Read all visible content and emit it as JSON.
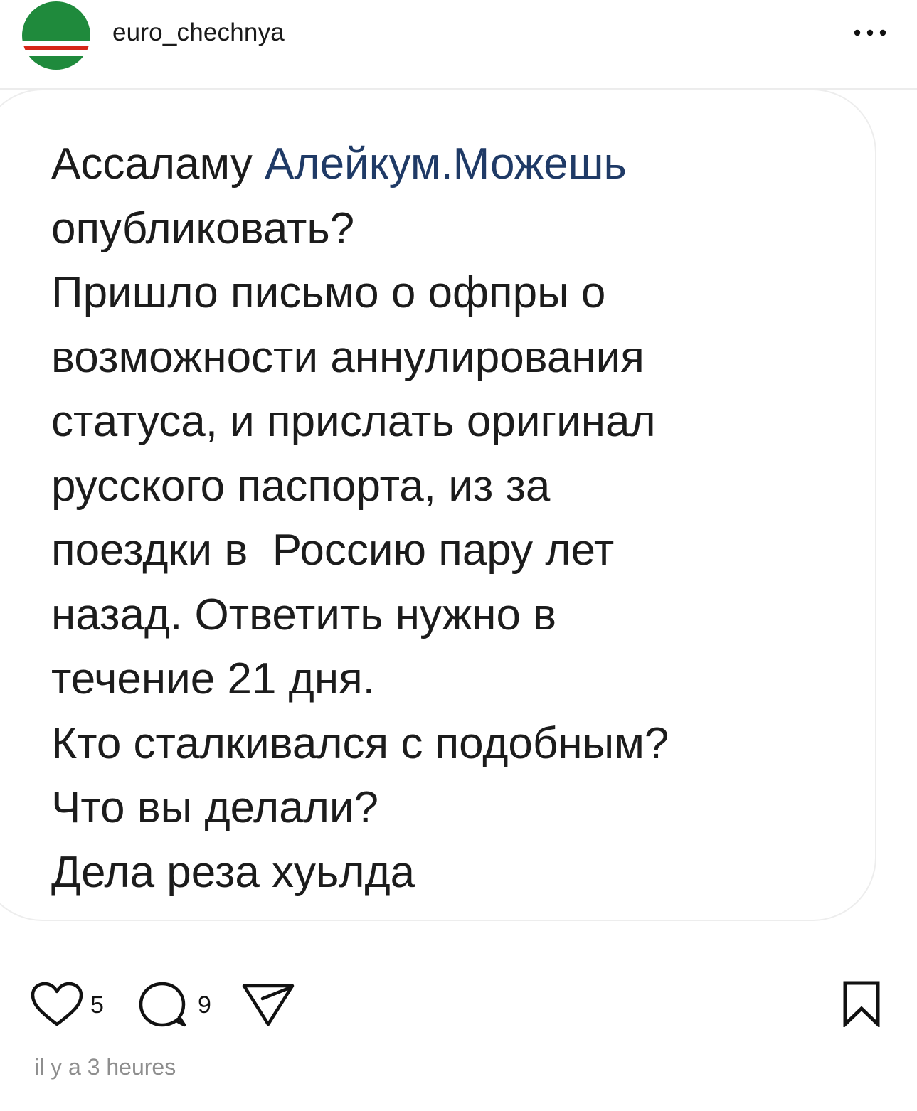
{
  "header": {
    "username": "euro_chechnya",
    "avatar_colors": {
      "top": "#1f8a3c",
      "middle": "#ffffff",
      "stripe": "#d62718",
      "bottom": "#1f8a3c"
    }
  },
  "post": {
    "lines": [
      {
        "plain": "Ассаламу ",
        "link": "Алейкум.Можешь"
      },
      {
        "plain": "опубликовать?"
      },
      {
        "plain": "Пришло письмо о офпры о"
      },
      {
        "plain": "возможности аннулирования"
      },
      {
        "plain": "статуса, и прислать оригинал"
      },
      {
        "plain": "русского паспорта, из за"
      },
      {
        "plain": "поездки в  Россию пару лет"
      },
      {
        "plain": "назад. Ответить нужно в"
      },
      {
        "plain": "течение 21 дня."
      },
      {
        "plain": "Кто сталкивался с подобным?"
      },
      {
        "plain": "Что вы делали?"
      },
      {
        "plain": "Дела реза хуьлда"
      }
    ],
    "link_color": "#1f3a66"
  },
  "actions": {
    "like_count": "5",
    "comment_count": "9",
    "like_icon": "heart-icon",
    "comment_icon": "comment-bubble-icon",
    "share_icon": "send-icon",
    "save_icon": "bookmark-icon"
  },
  "timestamp": "il y a 3 heures"
}
